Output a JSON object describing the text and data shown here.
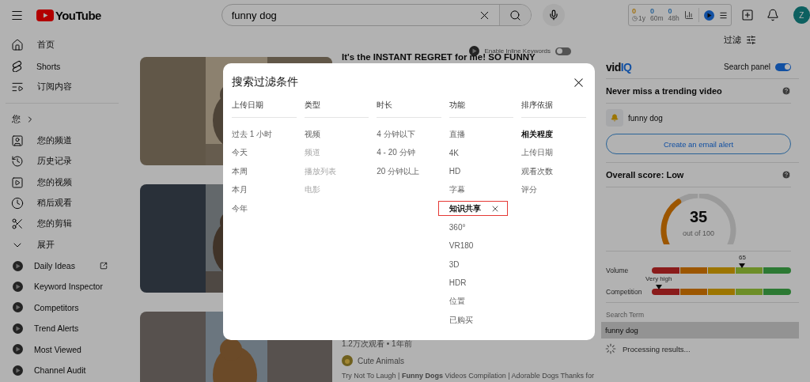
{
  "header": {
    "logo": "YouTube",
    "search": {
      "value": "funny dog"
    },
    "stats": [
      {
        "count": "0",
        "period": "1y"
      },
      {
        "count": "0",
        "period": "60m"
      },
      {
        "count": "0",
        "period": "48h"
      }
    ],
    "avatar": "Z"
  },
  "sidebar": {
    "main": [
      "首页",
      "Shorts",
      "订阅内容"
    ],
    "you_heading": "您",
    "you": [
      "您的频道",
      "历史记录",
      "您的视频",
      "稍后观看",
      "您的剪辑"
    ],
    "expand": "展开",
    "tools": [
      {
        "label": "Daily Ideas",
        "external": true
      },
      {
        "label": "Keyword Inspector",
        "external": false
      },
      {
        "label": "Competitors",
        "external": false
      },
      {
        "label": "Trend Alerts",
        "external": false
      },
      {
        "label": "Most Viewed",
        "external": false
      },
      {
        "label": "Channel Audit",
        "external": false
      }
    ]
  },
  "filter_button": "过滤",
  "inline_keywords": {
    "label": "Enable Inline Keywords",
    "on": false
  },
  "videos": [
    {
      "kind": "picture",
      "title": "It's the INSTANT REGRET for me! SO FUNNY"
    },
    {
      "kind": "picture"
    },
    {
      "kind": "picture",
      "views": "1.2万次观看 • 1年前",
      "channel": "Cute Animals",
      "description": "Try Not To Laugh | **Funny Dogs** Videos Compilation | Adorable Dogs Thanks for"
    }
  ],
  "filter_dialog": {
    "title": "搜索过滤条件",
    "groups": [
      {
        "heading": "上传日期",
        "options": [
          {
            "label": "过去 1 小时",
            "selected": false
          },
          {
            "label": "今天",
            "selected": false
          },
          {
            "label": "本周",
            "selected": false
          },
          {
            "label": "本月",
            "selected": false
          },
          {
            "label": "今年",
            "selected": false
          }
        ]
      },
      {
        "heading": "类型",
        "options": [
          {
            "label": "视频",
            "selected": false,
            "disabled": false
          },
          {
            "label": "频道",
            "selected": false,
            "disabled": true
          },
          {
            "label": "播放列表",
            "selected": false,
            "disabled": true
          },
          {
            "label": "电影",
            "selected": false,
            "disabled": true
          }
        ]
      },
      {
        "heading": "时长",
        "options": [
          {
            "label": "4 分钟以下",
            "selected": false
          },
          {
            "label": "4 - 20 分钟",
            "selected": false
          },
          {
            "label": "20 分钟以上",
            "selected": false
          }
        ]
      },
      {
        "heading": "功能",
        "options": [
          {
            "label": "直播",
            "selected": false
          },
          {
            "label": "4K",
            "selected": false
          },
          {
            "label": "HD",
            "selected": false
          },
          {
            "label": "字幕",
            "selected": false
          },
          {
            "label": "知识共享",
            "selected": true,
            "highlighted": true
          },
          {
            "label": "360°",
            "selected": false
          },
          {
            "label": "VR180",
            "selected": false
          },
          {
            "label": "3D",
            "selected": false
          },
          {
            "label": "HDR",
            "selected": false
          },
          {
            "label": "位置",
            "selected": false
          },
          {
            "label": "已购买",
            "selected": false
          }
        ]
      },
      {
        "heading": "排序依据",
        "options": [
          {
            "label": "相关程度",
            "selected": true
          },
          {
            "label": "上传日期",
            "selected": false
          },
          {
            "label": "观看次数",
            "selected": false
          },
          {
            "label": "评分",
            "selected": false
          }
        ]
      }
    ]
  },
  "vidiq": {
    "logo": [
      "vid",
      "IQ"
    ],
    "search_panel_label": "Search panel",
    "search_panel_on": true,
    "trending": {
      "heading": "Never miss a trending video",
      "keyword": "funny dog",
      "button": "Create an email alert"
    },
    "score": {
      "heading": "Overall score: Low",
      "value": "35",
      "caption": "out of 100"
    },
    "meters": [
      {
        "label": "Volume",
        "reading": "65",
        "level": 0.65
      },
      {
        "label": "Competition",
        "reading": "Very high",
        "level": 0.05
      }
    ],
    "search_term": {
      "label": "Search Term",
      "value": "funny dog"
    },
    "status": "Processing results..."
  }
}
